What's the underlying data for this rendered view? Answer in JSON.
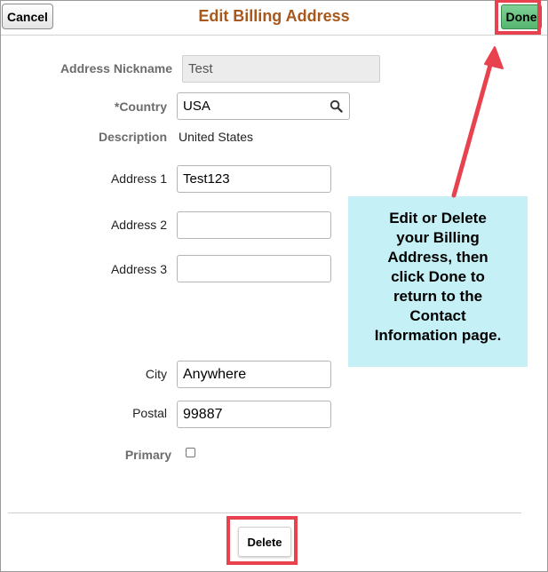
{
  "header": {
    "cancel_label": "Cancel",
    "title": "Edit Billing Address",
    "done_label": "Done"
  },
  "form": {
    "nickname_label": "Address Nickname",
    "nickname_value": "Test",
    "country_label": "*Country",
    "country_value": "USA",
    "description_label": "Description",
    "description_value": "United States",
    "address1_label": "Address 1",
    "address1_value": "Test123",
    "address2_label": "Address 2",
    "address2_value": "",
    "address3_label": "Address 3",
    "address3_value": "",
    "city_label": "City",
    "city_value": "Anywhere",
    "postal_label": "Postal",
    "postal_value": "99887",
    "primary_label": "Primary",
    "primary_checked": false
  },
  "footer": {
    "delete_label": "Delete"
  },
  "callout": {
    "lines": [
      "Edit or Delete",
      "your Billing",
      "Address, then",
      "click Done to",
      "return to the",
      "Contact",
      "Information page."
    ]
  },
  "colors": {
    "title": "#a8581c",
    "done_button": "#56b670",
    "highlight": "#e9424f",
    "callout_bg": "#c4f0f6"
  },
  "icons": {
    "country_lookup": "search-icon",
    "annotation_arrow": "arrow-icon"
  }
}
